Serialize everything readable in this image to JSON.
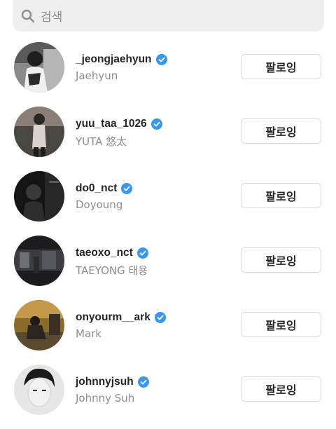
{
  "search": {
    "placeholder": "검색",
    "icon": "search-icon"
  },
  "colors": {
    "verified": "#3897f0",
    "secondary_text": "#8e8e8e",
    "border": "#dbdbdb"
  },
  "accounts": [
    {
      "username": "_jeongjaehyun",
      "full_name": "Jaehyun",
      "verified": true,
      "button": "팔로잉"
    },
    {
      "username": "yuu_taa_1026",
      "full_name": "YUTA 悠太",
      "verified": true,
      "button": "팔로잉"
    },
    {
      "username": "do0_nct",
      "full_name": "Doyoung",
      "verified": true,
      "button": "팔로잉"
    },
    {
      "username": "taeoxo_nct",
      "full_name": "TAEYONG 태용",
      "verified": true,
      "button": "팔로잉"
    },
    {
      "username": "onyourm__ark",
      "full_name": "Mark",
      "verified": true,
      "button": "팔로잉"
    },
    {
      "username": "johnnyjsuh",
      "full_name": "Johnny Suh",
      "verified": true,
      "button": "팔로잉"
    }
  ]
}
